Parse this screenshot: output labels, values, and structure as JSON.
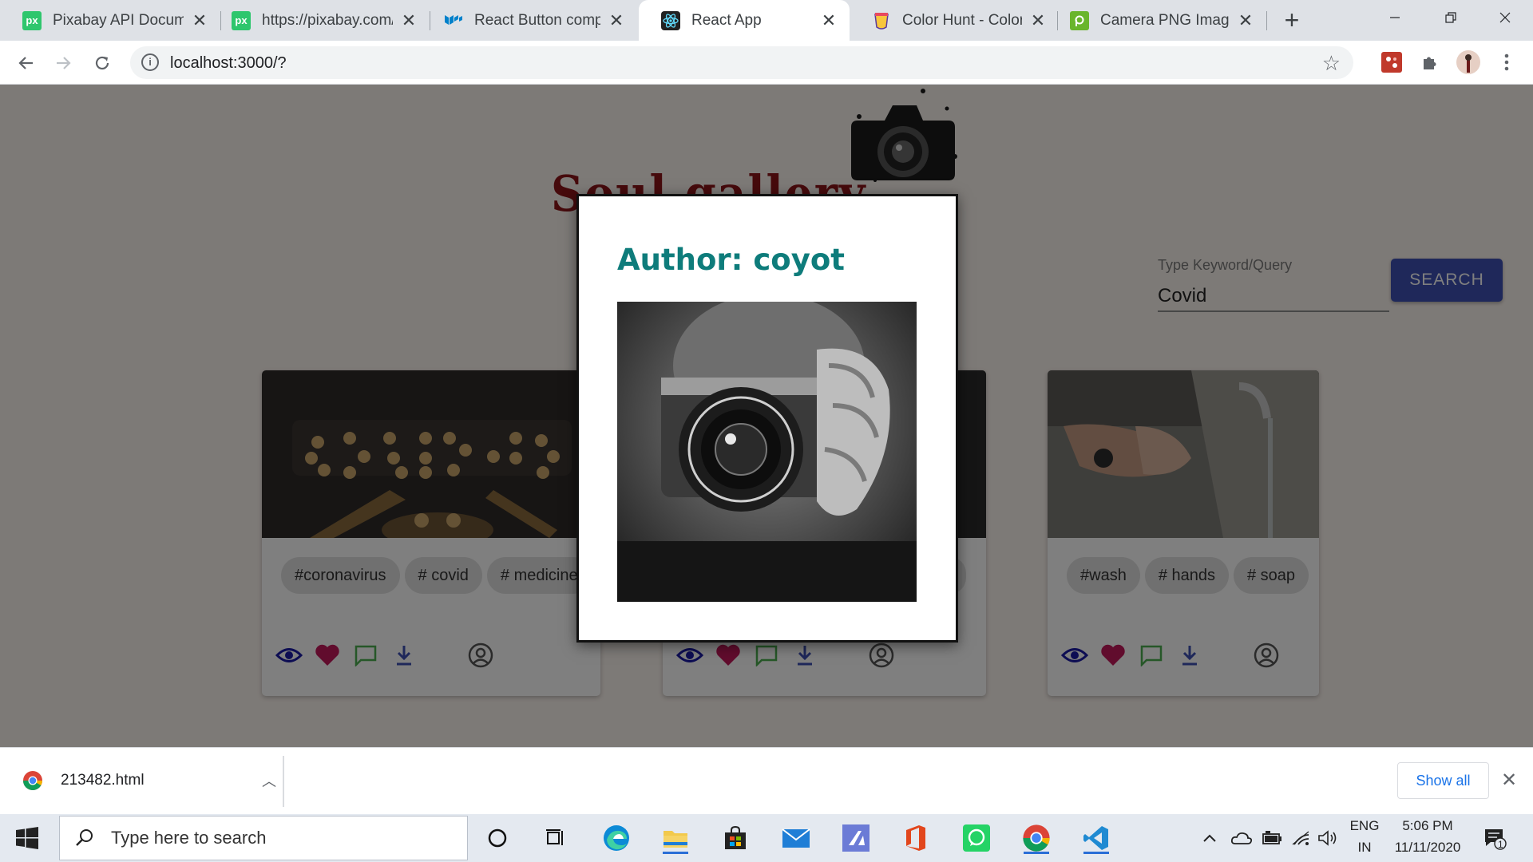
{
  "browser": {
    "tabs": [
      {
        "title": "Pixabay API Documentation",
        "icon": "pixabay-icon"
      },
      {
        "title": "https://pixabay.com/",
        "icon": "pixabay-icon"
      },
      {
        "title": "React Button component",
        "icon": "material-ui-icon"
      },
      {
        "title": "React App",
        "icon": "react-icon",
        "active": true
      },
      {
        "title": "Color Hunt - Color Palettes",
        "icon": "colorhunt-icon"
      },
      {
        "title": "Camera PNG Images",
        "icon": "pngtree-icon"
      }
    ],
    "new_tab_label": "+",
    "url": "localhost:3000/?"
  },
  "page": {
    "brand_title": "Soul gallery",
    "search": {
      "label": "Type Keyword/Query",
      "value": "Covid",
      "button_label": "SEARCH"
    },
    "cards": [
      {
        "tags": [
          "#coronavirus",
          "# covid",
          "# medicine"
        ]
      },
      {
        "tags": []
      },
      {
        "tags": [
          "#wash",
          "# hands",
          "# soap"
        ]
      }
    ]
  },
  "modal": {
    "title": "Author: coyot"
  },
  "downloads": {
    "filename": "213482.html",
    "show_all_label": "Show all"
  },
  "taskbar": {
    "search_placeholder": "Type here to search",
    "language": "ENG",
    "region": "IN",
    "time": "5:06 PM",
    "date": "11/11/2020",
    "notification_count": "1"
  },
  "colors": {
    "accent": "#3f51b5",
    "modal_title": "#0e7c7b",
    "brand": "#8c1418",
    "heart": "#c2185b"
  }
}
